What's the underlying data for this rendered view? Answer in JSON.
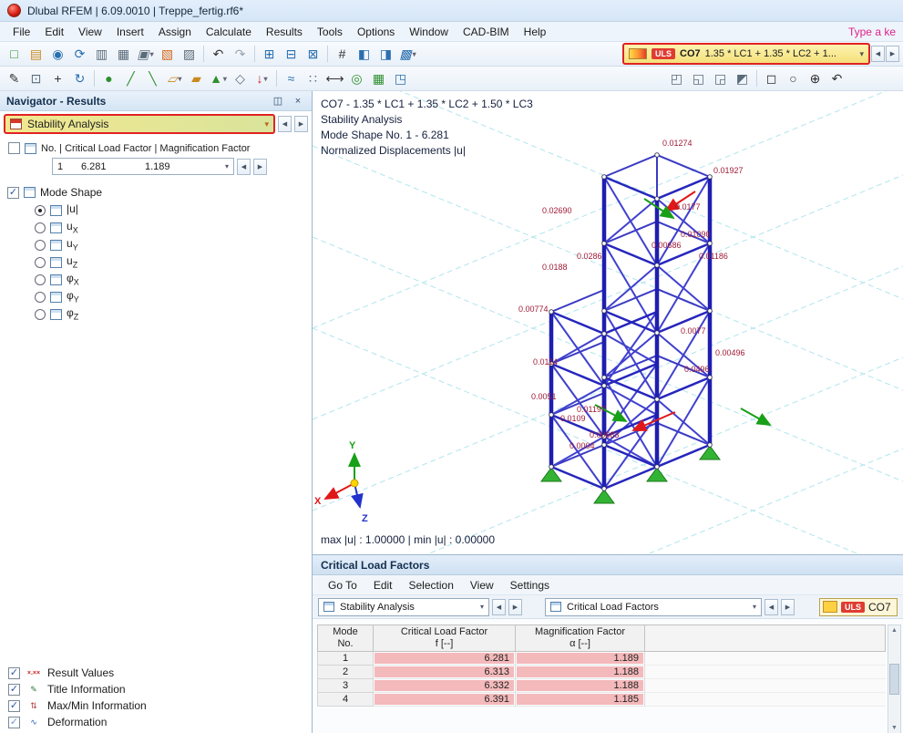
{
  "window": {
    "title": "Dlubal RFEM | 6.09.0010 | Treppe_fertig.rf6*"
  },
  "menubar": {
    "items": [
      "File",
      "Edit",
      "View",
      "Insert",
      "Assign",
      "Calculate",
      "Results",
      "Tools",
      "Options",
      "Window",
      "CAD-BIM",
      "Help"
    ],
    "search_hint": "Type a ke"
  },
  "ui": {
    "left_arrow": "◀",
    "right_arrow": "▶",
    "chevron": "▾",
    "check": "✓",
    "close": "×",
    "pin": "◫",
    "up_arrow": "▲",
    "down_arrow": "▼"
  },
  "toolbar1": {
    "icons": [
      {
        "name": "new-model-icon",
        "glyph": "□"
      },
      {
        "name": "open-model-icon",
        "glyph": "▤"
      },
      {
        "name": "dlubal-online-icon",
        "glyph": "◉"
      },
      {
        "name": "model-sync-icon",
        "glyph": "⟳"
      },
      {
        "name": "printout-report-icon",
        "glyph": "▥"
      },
      {
        "name": "save-icon",
        "glyph": "▦"
      },
      {
        "name": "print-icon",
        "glyph": "▣"
      },
      {
        "name": "manuals-icon",
        "glyph": "▧"
      },
      {
        "name": "clipboard-icon",
        "glyph": "▨"
      },
      {
        "name": "undo-icon",
        "glyph": "↶"
      },
      {
        "name": "redo-icon",
        "glyph": "↷"
      },
      {
        "name": "tables-icon",
        "glyph": "⊞"
      },
      {
        "name": "table-manager-icon",
        "glyph": "⊟"
      },
      {
        "name": "section-icon",
        "glyph": "⊠"
      },
      {
        "name": "numbering-icon",
        "glyph": "#"
      },
      {
        "name": "display-properties-icon",
        "glyph": "◧"
      },
      {
        "name": "render-mode-icon",
        "glyph": "◨"
      },
      {
        "name": "show-results-icon",
        "glyph": "▩"
      }
    ],
    "combo": {
      "uls": "ULS",
      "co": "CO7",
      "formula": "1.35 * LC1 + 1.35 * LC2 + 1..."
    }
  },
  "toolbar2": {
    "icons": [
      {
        "name": "edit-icon",
        "glyph": "✎"
      },
      {
        "name": "copy-icon",
        "glyph": "⊡"
      },
      {
        "name": "move-icon",
        "glyph": "+"
      },
      {
        "name": "rotate-icon",
        "glyph": "↻"
      },
      {
        "name": "new-node-icon",
        "glyph": "●"
      },
      {
        "name": "new-line-icon",
        "glyph": "╱"
      },
      {
        "name": "new-member-icon",
        "glyph": "╲"
      },
      {
        "name": "new-surface-icon",
        "glyph": "▱"
      },
      {
        "name": "new-solid-icon",
        "glyph": "▰"
      },
      {
        "name": "new-support-icon",
        "glyph": "▲"
      },
      {
        "name": "new-hinge-icon",
        "glyph": "◇"
      },
      {
        "name": "new-load-icon",
        "glyph": "↓"
      },
      {
        "name": "imperfection-icon",
        "glyph": "≈"
      },
      {
        "name": "guideline-icon",
        "glyph": "∷"
      },
      {
        "name": "dimension-icon",
        "glyph": "⟷"
      },
      {
        "name": "object-snap-icon",
        "glyph": "◎"
      },
      {
        "name": "grid-snap-icon",
        "glyph": "▦"
      },
      {
        "name": "work-plane-icon",
        "glyph": "◳"
      }
    ],
    "right_icons": [
      {
        "name": "view-in-x-icon",
        "glyph": "◰"
      },
      {
        "name": "view-in-y-icon",
        "glyph": "◱"
      },
      {
        "name": "view-in-z-icon",
        "glyph": "◲"
      },
      {
        "name": "isometric-view-icon",
        "glyph": "◩"
      },
      {
        "name": "zoom-window-icon",
        "glyph": "◻"
      },
      {
        "name": "zoom-icon",
        "glyph": "○"
      },
      {
        "name": "pan-icon",
        "glyph": "⊕"
      },
      {
        "name": "previous-view-icon",
        "glyph": "↶"
      }
    ]
  },
  "navigator": {
    "title": "Navigator - Results",
    "analysis_combo": "Stability Analysis",
    "factor_label": "No. | Critical Load Factor | Magnification Factor",
    "factor_no": "1",
    "factor_f": "6.281",
    "factor_alpha": "1.189",
    "mode_shape_label": "Mode Shape",
    "options": [
      {
        "main": "|u|"
      },
      {
        "main": "u",
        "sub": "X"
      },
      {
        "main": "u",
        "sub": "Y"
      },
      {
        "main": "u",
        "sub": "Z"
      },
      {
        "main": "φ",
        "sub": "X"
      },
      {
        "main": "φ",
        "sub": "Y"
      },
      {
        "main": "φ",
        "sub": "Z"
      }
    ],
    "footer_items": [
      {
        "glyph": "×.××",
        "label": "Result Values"
      },
      {
        "glyph": "✎",
        "label": "Title Information"
      },
      {
        "glyph": "⇅",
        "label": "Max/Min Information"
      },
      {
        "glyph": "∿",
        "label": "Deformation"
      }
    ]
  },
  "viewport": {
    "info": [
      "CO7 - 1.35 * LC1 + 1.35 * LC2 + 1.50 * LC3",
      "Stability Analysis",
      "Mode Shape No. 1 - 6.281",
      "Normalized Displacements |u|"
    ],
    "status": "max |u| : 1.00000 | min |u| : 0.00000",
    "axis": {
      "x": "X",
      "y": "Y",
      "z": "Z"
    },
    "annotations": [
      "0.01274",
      "0.01927",
      "0.02690",
      "0.0177",
      "0.01090",
      "0.00686",
      "0.01186",
      "0.0286",
      "0.0188",
      "0.00774",
      "0.0077",
      "0.00496",
      "0.0114",
      "0.0496",
      "0.0051",
      "0.01197",
      "0.0109",
      "0.00683",
      "0.0004"
    ]
  },
  "panel": {
    "title": "Critical Load Factors",
    "menu": [
      "Go To",
      "Edit",
      "Selection",
      "View",
      "Settings"
    ],
    "combo1": "Stability Analysis",
    "combo2": "Critical Load Factors",
    "uls": "ULS",
    "co": "CO7",
    "table": {
      "h_mode1": "Mode",
      "h_mode2": "No.",
      "h_clf1": "Critical Load Factor",
      "h_clf2": "f [--]",
      "h_mag1": "Magnification Factor",
      "h_mag2": "α [--]",
      "rows": [
        {
          "no": "1",
          "f": "6.281",
          "a": "1.189"
        },
        {
          "no": "2",
          "f": "6.313",
          "a": "1.188"
        },
        {
          "no": "3",
          "f": "6.332",
          "a": "1.188"
        },
        {
          "no": "4",
          "f": "6.391",
          "a": "1.185"
        }
      ]
    }
  },
  "colors": {
    "highlight_border": "#e02222",
    "uls_red": "#e03c31",
    "bar_pink": "#f4b9bb",
    "member_blue": "#2323bd",
    "support_green": "#2fa82f",
    "annotation_red": "#a01b36",
    "grid_cyan": "#a8e3ec"
  }
}
